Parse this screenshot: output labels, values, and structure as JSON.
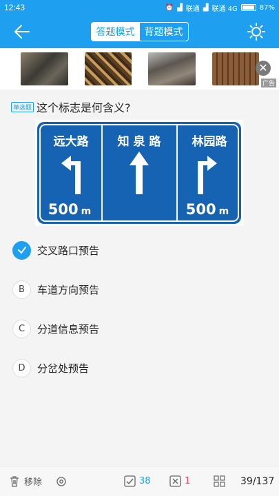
{
  "status_bar": {
    "time": "12:43",
    "carrier1": "联通",
    "carrier2": "联通 4G",
    "battery": "87%",
    "battery_level": 0.87
  },
  "header": {
    "modes": [
      {
        "label": "答题模式",
        "active": true
      },
      {
        "label": "背题模式",
        "active": false
      }
    ],
    "back_icon": "back-arrow-icon",
    "theme_icon": "sun-icon"
  },
  "ad": {
    "label": "广告",
    "close_glyph": "✕",
    "images": [
      "black-stones-ad",
      "wooden-sticks-ad",
      "wood-crates-ad",
      "warehouse-racks-ad"
    ]
  },
  "question": {
    "type": "单选题",
    "text": "这个标志是何含义?"
  },
  "sign": {
    "colors": {
      "background": "#1763b3",
      "border": "#ffffff"
    },
    "panels": [
      {
        "name": "远大路",
        "distance": "500",
        "unit": "m",
        "arrow": "left-turn"
      },
      {
        "name": "知 泉 路",
        "arrow": "straight"
      },
      {
        "name": "林园路",
        "distance": "500",
        "unit": "m",
        "arrow": "right-turn"
      }
    ]
  },
  "options": [
    {
      "letter": "A",
      "text": "交叉路口预告",
      "selected": true
    },
    {
      "letter": "B",
      "text": "车道方向预告",
      "selected": false
    },
    {
      "letter": "C",
      "text": "分道信息预告",
      "selected": false
    },
    {
      "letter": "D",
      "text": "分岔处预告",
      "selected": false
    }
  ],
  "footer": {
    "remove_label": "移除",
    "correct_count": "38",
    "wrong_count": "1",
    "progress": "39/137"
  },
  "colors": {
    "accent": "#1e9ff0",
    "correct": "#1e9ff0",
    "wrong": "#e8465a"
  }
}
